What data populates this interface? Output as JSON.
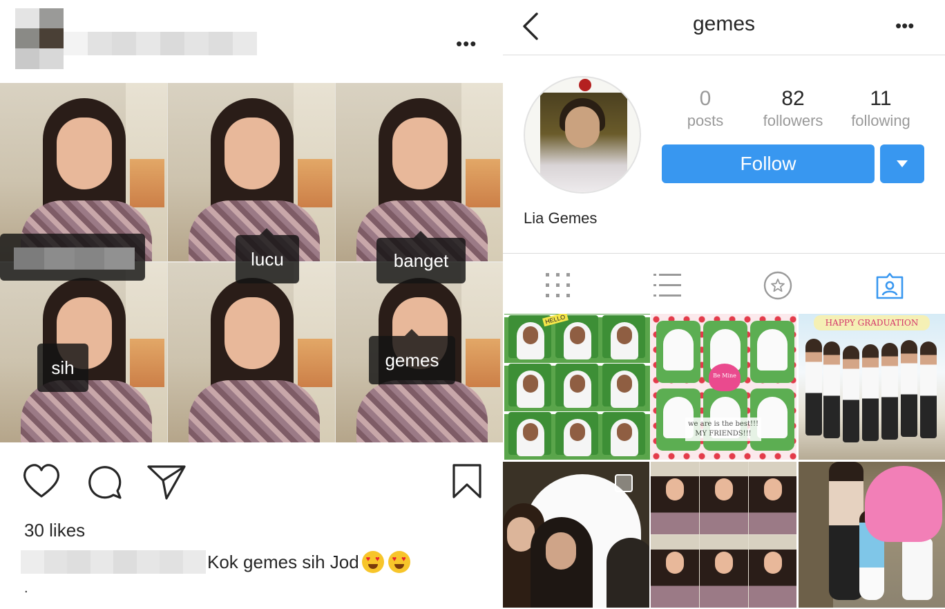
{
  "post": {
    "tags": [
      "lucu",
      "banget",
      "sih",
      "gemes"
    ],
    "likes": "30 likes",
    "caption_text": "Kok gemes sih Jod",
    "caption_trail": ".",
    "icons": {
      "more": "more-horizontal-icon",
      "like": "heart-icon",
      "comment": "comment-icon",
      "share": "paper-plane-icon",
      "save": "bookmark-icon"
    }
  },
  "profile": {
    "username": "gemes",
    "full_name": "Lia Gemes",
    "stats": {
      "posts": {
        "value": "0",
        "label": "posts"
      },
      "followers": {
        "value": "82",
        "label": "followers"
      },
      "following": {
        "value": "11",
        "label": "following"
      }
    },
    "follow_label": "Follow",
    "tabs": [
      "grid-icon",
      "list-icon",
      "star-icon",
      "tagged-icon"
    ],
    "active_tab": "tagged",
    "grid_texts": {
      "hello": "HELLO",
      "be_mine": "Be Mine",
      "friends_note": "we are is the best!!! MY FRIENDS!!!",
      "graduation": "HAPPY GRADUATION"
    }
  },
  "colors": {
    "accent": "#3897f0",
    "divider": "#dbdbdb",
    "text": "#262626",
    "muted": "#999999",
    "tab_active": "#3897f0"
  }
}
